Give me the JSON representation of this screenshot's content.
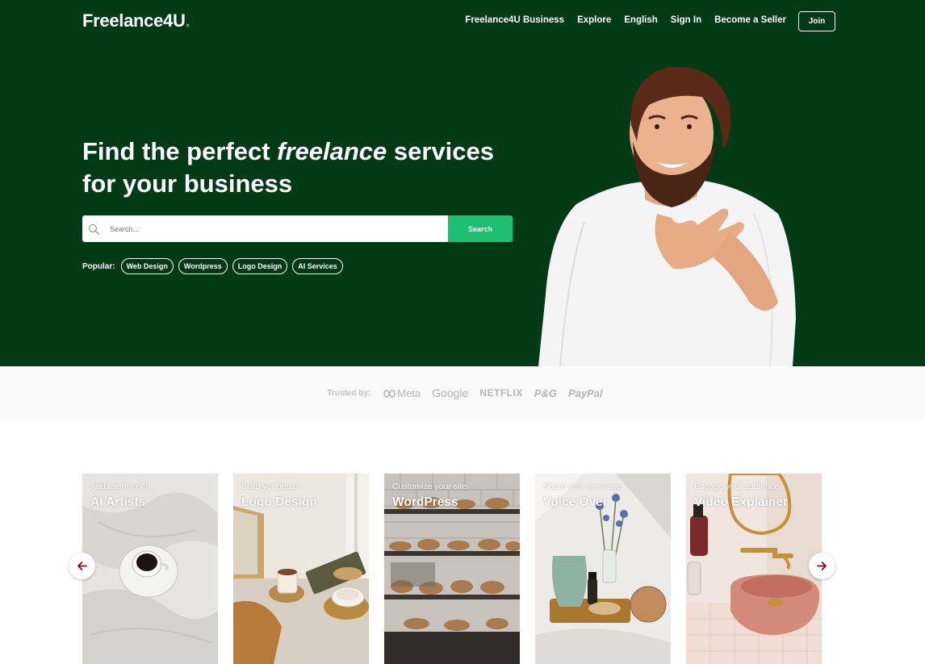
{
  "header": {
    "logo_text": "Freelance4U",
    "logo_dot": ".",
    "nav": [
      {
        "label": "Freelance4U Business"
      },
      {
        "label": "Explore"
      },
      {
        "label": "English"
      },
      {
        "label": "Sign In"
      },
      {
        "label": "Become a Seller"
      }
    ],
    "join_label": "Join"
  },
  "hero": {
    "headline_pre": "Find the perfect ",
    "headline_em": "freelance",
    "headline_post": " services",
    "headline_line2": "for your business",
    "search_placeholder": "Search...",
    "search_button": "Search",
    "popular_label": "Popular:",
    "popular_tags": [
      "Web Design",
      "Wordpress",
      "Logo Design",
      "AI Services"
    ]
  },
  "trusted": {
    "label": "Trusted by:",
    "brands": [
      "Meta",
      "Google",
      "NETFLIX",
      "P&G",
      "PayPal"
    ]
  },
  "cards": [
    {
      "subtitle": "Add talent to AI",
      "title": "AI Artists"
    },
    {
      "subtitle": "Build yor brand",
      "title": "Logo Design"
    },
    {
      "subtitle": "Customize your site",
      "title": "WordPress"
    },
    {
      "subtitle": "Share your message",
      "title": "Voice Over"
    },
    {
      "subtitle": "Engage your audience",
      "title": "Video Explainer"
    }
  ],
  "colors": {
    "hero_bg": "#013a14",
    "accent": "#1dbf73",
    "arrow": "#8b0000"
  },
  "icons": {
    "search": "search-icon",
    "prev": "arrow-left-icon",
    "next": "arrow-right-icon",
    "meta": "meta-infinity-icon"
  }
}
